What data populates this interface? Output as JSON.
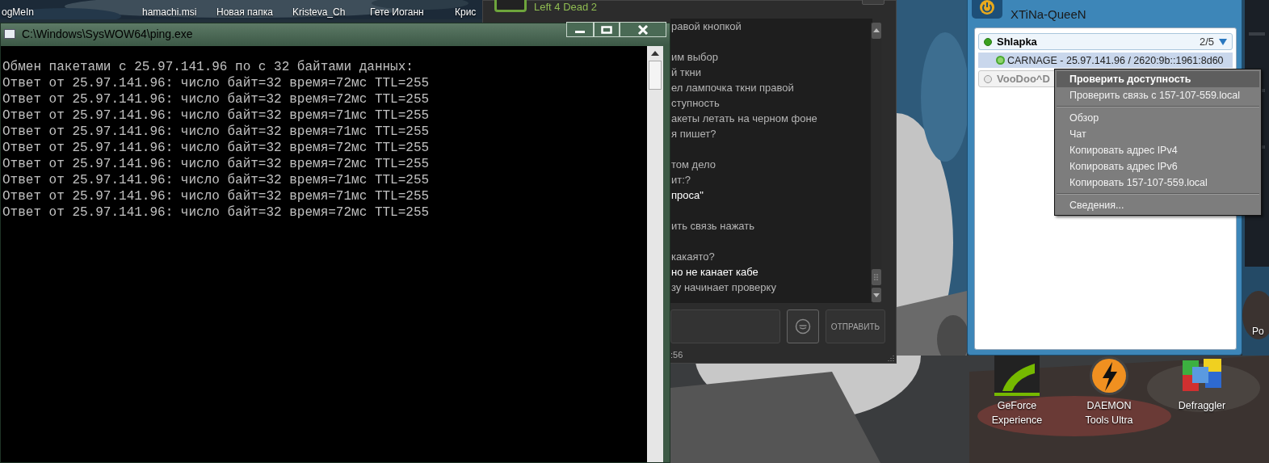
{
  "desktop": {
    "top_icon_labels": [
      "ogMeIn",
      "hamachi.msi",
      "Новая папка",
      "Kristeva_Ch",
      "Гете Иоганн",
      "Крис"
    ],
    "icons": [
      {
        "label": "GeForce Experience",
        "kind": "geforce"
      },
      {
        "label": "DAEMON Tools Ultra",
        "kind": "daemon"
      },
      {
        "label": "Defraggler",
        "kind": "defraggler"
      }
    ],
    "edge_label": "Po"
  },
  "console_window": {
    "title": "C:\\Windows\\SysWOW64\\ping.exe",
    "lines": [
      "Обмен пакетами с 25.97.141.96 по с 32 байтами данных:",
      "Ответ от 25.97.141.96: число байт=32 время=72мс TTL=255",
      "Ответ от 25.97.141.96: число байт=32 время=72мс TTL=255",
      "Ответ от 25.97.141.96: число байт=32 время=71мс TTL=255",
      "Ответ от 25.97.141.96: число байт=32 время=71мс TTL=255",
      "Ответ от 25.97.141.96: число байт=32 время=72мс TTL=255",
      "Ответ от 25.97.141.96: число байт=32 время=72мс TTL=255",
      "Ответ от 25.97.141.96: число байт=32 время=71мс TTL=255",
      "Ответ от 25.97.141.96: число байт=32 время=71мс TTL=255",
      "Ответ от 25.97.141.96: число байт=32 время=72мс TTL=255"
    ]
  },
  "chat_window": {
    "game": "Left 4 Dead 2",
    "message_groups": [
      {
        "lines": [
          {
            "text": "равой кнопкой",
            "emphasis": false
          }
        ]
      },
      {
        "lines": [
          {
            "text": "им выбор",
            "emphasis": false
          },
          {
            "text": "й ткни",
            "emphasis": false
          },
          {
            "text": "ел лампочка ткни правой",
            "emphasis": false
          },
          {
            "text": "ступность",
            "emphasis": false
          },
          {
            "text": "акеты летать на черном фоне",
            "emphasis": false
          },
          {
            "text": "я пишет?",
            "emphasis": false
          }
        ]
      },
      {
        "lines": [
          {
            "text": "том дело",
            "emphasis": false
          },
          {
            "text": "ит:?",
            "emphasis": false
          },
          {
            "text": "проса\"",
            "emphasis": true
          }
        ]
      },
      {
        "lines": [
          {
            "text": "ить связь нажать",
            "emphasis": false
          }
        ]
      },
      {
        "lines": [
          {
            "text": "какаято?",
            "emphasis": false
          },
          {
            "text": "но не канает кабе",
            "emphasis": true
          },
          {
            "text": "зу начинает проверку",
            "emphasis": false
          }
        ]
      }
    ],
    "send_button": "ОТПРАВИТЬ",
    "timestamp": ":56"
  },
  "hamachi_window": {
    "nickname": "XTiNa-QueeN",
    "networks": [
      {
        "name": "Shlapka",
        "count": "2/5",
        "online": true,
        "members": [
          {
            "name": "CARNAGE - 25.97.141.96 / 2620:9b::1961:8d60",
            "online": true,
            "selected": true
          }
        ]
      },
      {
        "name": "VooDoo^D",
        "online": false
      }
    ]
  },
  "context_menu": {
    "items": [
      {
        "kind": "item",
        "label": "Проверить доступность",
        "selected": true
      },
      {
        "kind": "item",
        "label": "Проверить связь с 157-107-559.local",
        "selected": false
      },
      {
        "kind": "separator"
      },
      {
        "kind": "item",
        "label": "Обзор",
        "selected": false
      },
      {
        "kind": "item",
        "label": "Чат",
        "selected": false
      },
      {
        "kind": "item",
        "label": "Копировать адрес IPv4",
        "selected": false
      },
      {
        "kind": "item",
        "label": "Копировать адрес IPv6",
        "selected": false
      },
      {
        "kind": "item",
        "label": "Копировать 157-107-559.local",
        "selected": false
      },
      {
        "kind": "separator"
      },
      {
        "kind": "item",
        "label": "Сведения...",
        "selected": false
      }
    ]
  }
}
